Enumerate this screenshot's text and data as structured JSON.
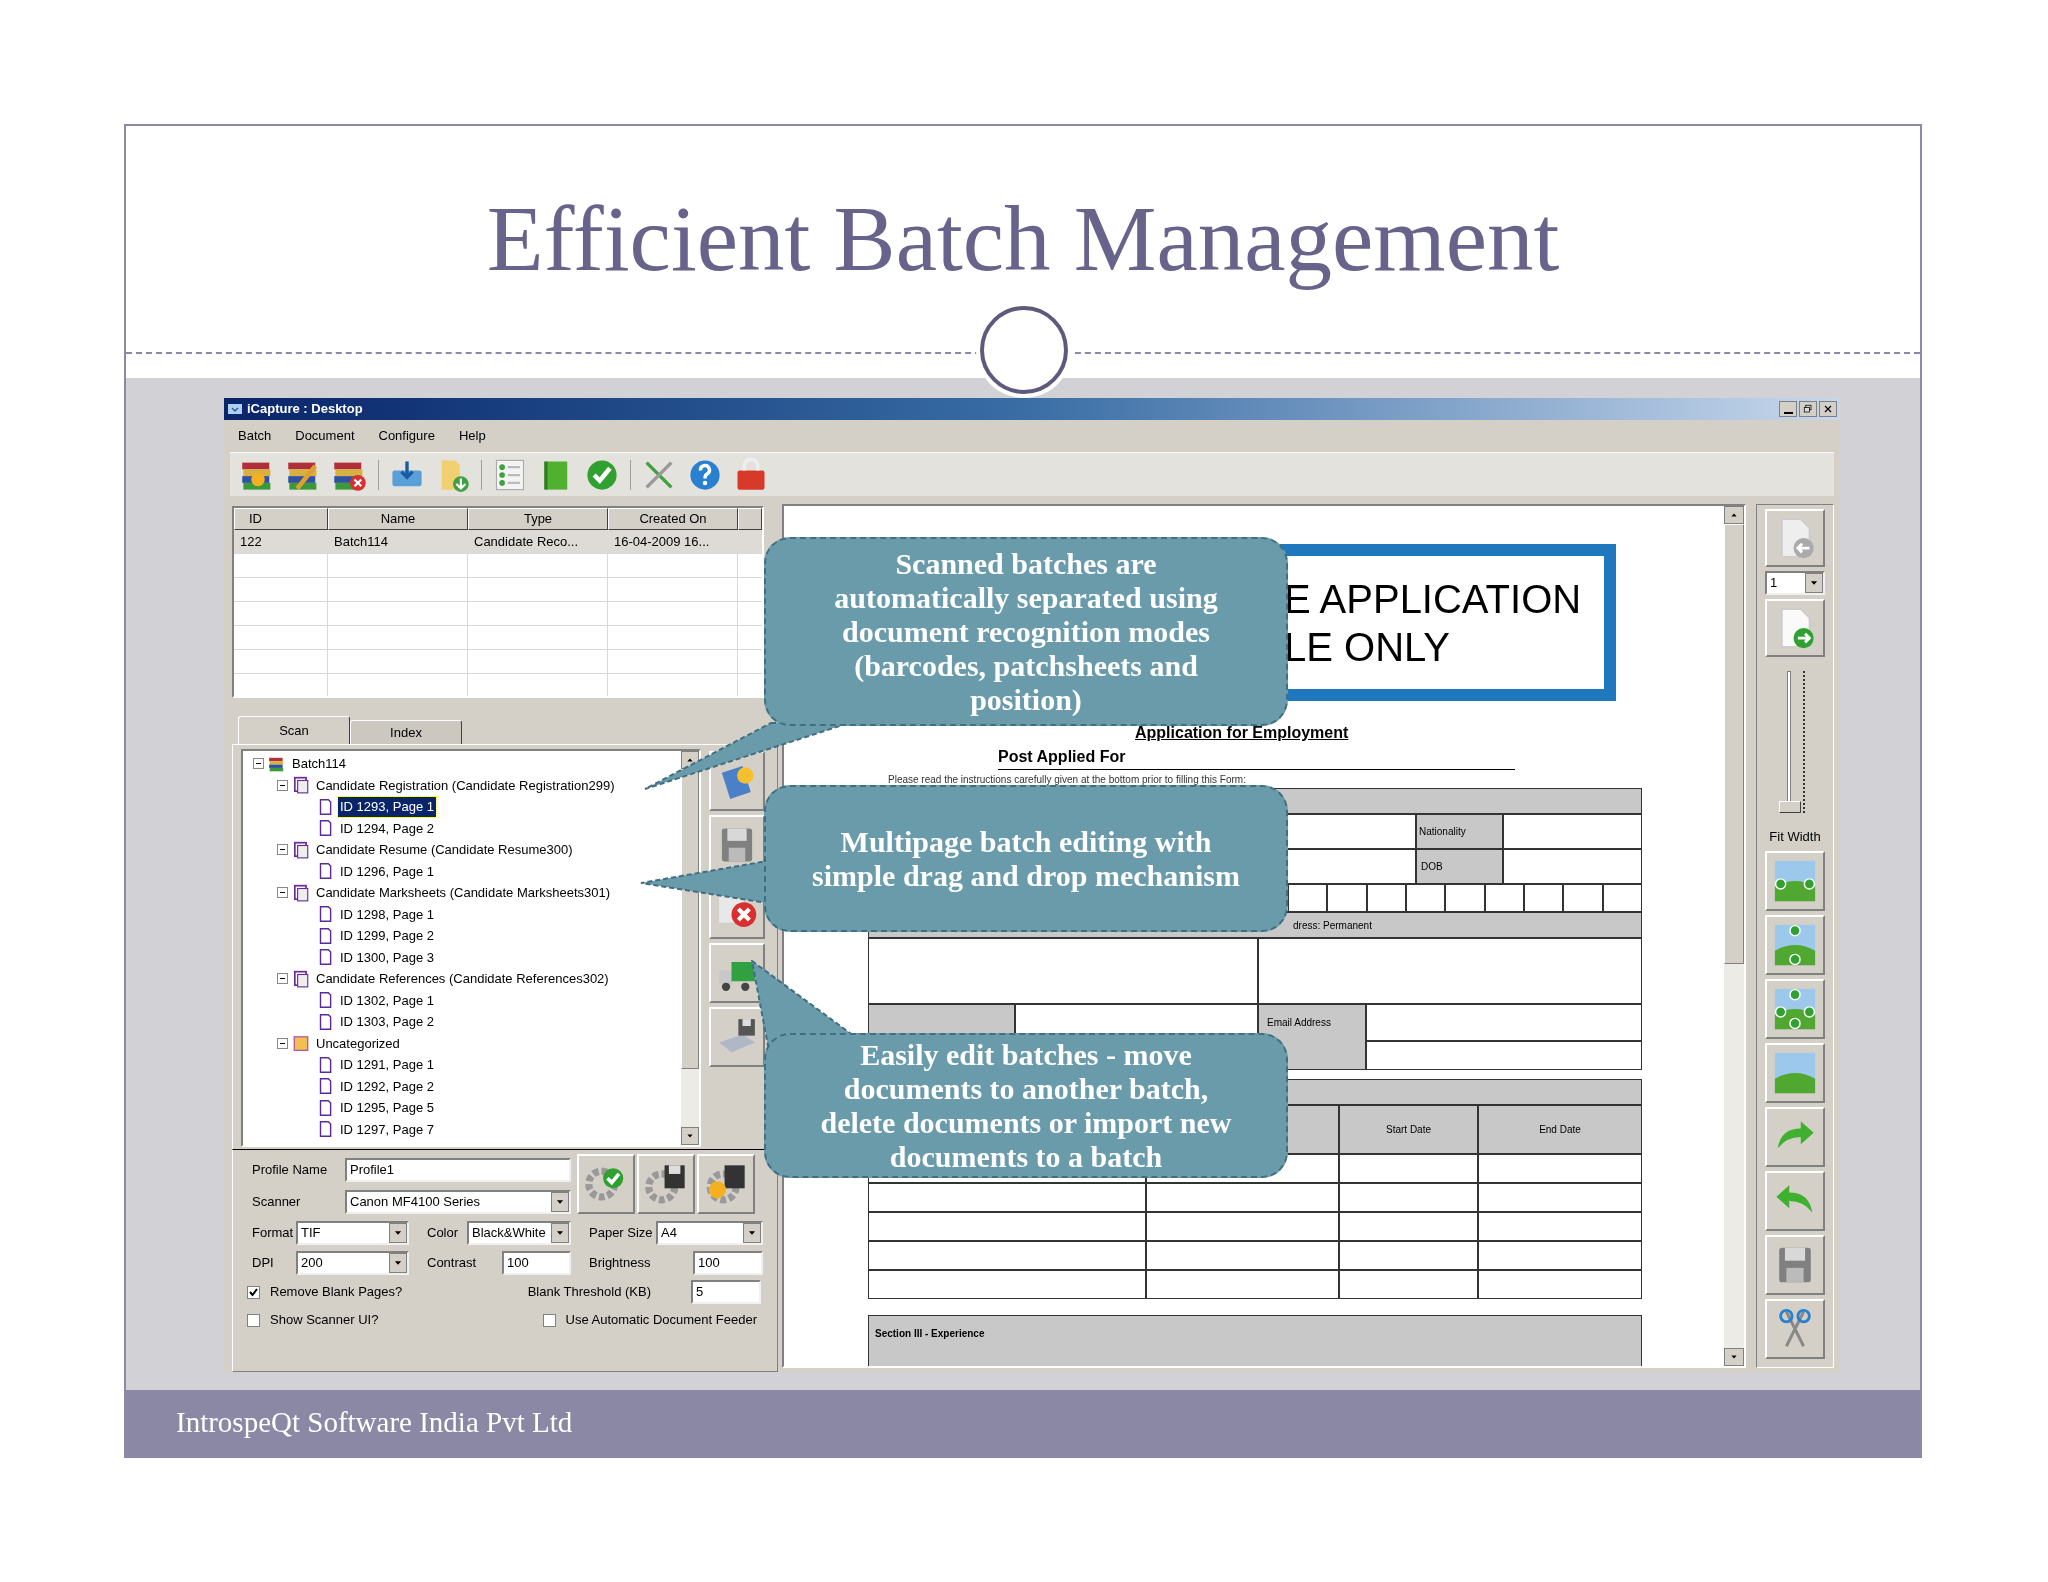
{
  "slide": {
    "title": "Efficient Batch Management",
    "footer": "IntrospeQt Software India Pvt Ltd"
  },
  "window": {
    "title": "iCapture : Desktop"
  },
  "menu": [
    "Batch",
    "Document",
    "Configure",
    "Help"
  ],
  "batch_table": {
    "columns": [
      "ID",
      "Name",
      "Type",
      "Created On"
    ],
    "rows": [
      {
        "cells": [
          "122",
          "Batch114",
          "Candidate Reco...",
          "16-04-2009 16..."
        ],
        "selected": true
      }
    ]
  },
  "tabs": [
    {
      "label": "Scan",
      "selected": true
    },
    {
      "label": "Index",
      "selected": false
    }
  ],
  "tree": {
    "label": "Batch114",
    "kind": "batch",
    "expanded": true,
    "children": [
      {
        "label": "Candidate Registration (Candidate Registration299)",
        "kind": "group",
        "expanded": true,
        "children": [
          {
            "label": "ID 1293, Page 1",
            "kind": "page",
            "selected": true
          },
          {
            "label": "ID 1294, Page 2",
            "kind": "page",
            "selected": false
          }
        ]
      },
      {
        "label": "Candidate Resume (Candidate Resume300)",
        "kind": "group",
        "expanded": true,
        "children": [
          {
            "label": "ID 1296, Page 1",
            "kind": "page",
            "selected": false
          }
        ]
      },
      {
        "label": "Candidate Marksheets (Candidate Marksheets301)",
        "kind": "group",
        "expanded": true,
        "children": [
          {
            "label": "ID 1298, Page 1",
            "kind": "page",
            "selected": false
          },
          {
            "label": "ID 1299, Page 2",
            "kind": "page",
            "selected": false
          },
          {
            "label": "ID 1300, Page 3",
            "kind": "page",
            "selected": false
          }
        ]
      },
      {
        "label": "Candidate References (Candidate References302)",
        "kind": "group",
        "expanded": true,
        "children": [
          {
            "label": "ID 1302, Page 1",
            "kind": "page",
            "selected": false
          },
          {
            "label": "ID 1303, Page 2",
            "kind": "page",
            "selected": false
          }
        ]
      },
      {
        "label": "Uncategorized",
        "kind": "folder",
        "expanded": true,
        "children": [
          {
            "label": "ID 1291, Page 1",
            "kind": "page",
            "selected": false
          },
          {
            "label": "ID 1292, Page 2",
            "kind": "page",
            "selected": false
          },
          {
            "label": "ID 1295, Page 5",
            "kind": "page",
            "selected": false
          },
          {
            "label": "ID 1297, Page 7",
            "kind": "page",
            "selected": false
          }
        ]
      }
    ]
  },
  "profile": {
    "name_field": {
      "label": "Profile Name",
      "value": "Profile1"
    },
    "scanner_field": {
      "label": "Scanner",
      "value": "Canon MF4100 Series"
    },
    "row_a": [
      {
        "label": "Format",
        "value": "TIF",
        "kind": "select"
      },
      {
        "label": "Color",
        "value": "Black&White",
        "kind": "select"
      },
      {
        "label": "Paper Size",
        "value": "A4",
        "kind": "select"
      }
    ],
    "row_b": [
      {
        "label": "DPI",
        "value": "200",
        "kind": "select"
      },
      {
        "label": "Contrast",
        "value": "100",
        "kind": "text"
      },
      {
        "label": "Brightness",
        "value": "100",
        "kind": "text"
      }
    ],
    "remove_blank": {
      "label": "Remove Blank Pages?",
      "checked": true
    },
    "threshold": {
      "label": "Blank Threshold (KB)",
      "value": "5"
    },
    "show_ui": {
      "label": "Show Scanner UI?",
      "checked": false
    },
    "adf": {
      "label": "Use Automatic Document Feeder",
      "checked": false
    }
  },
  "document": {
    "banner": [
      "E APPLICATION",
      "LE ONLY"
    ],
    "form_title": "Application for Employment",
    "post_label": "Post Applied For",
    "instructions": "Please read the instructions carefully given at the bottom prior to filling this Form:",
    "nationality": "Nationality",
    "dob": "DOB",
    "address": "dress: Permanent",
    "email": "Email Address",
    "start_date": "Start Date",
    "end_date": "End Date",
    "section": "Section III - Experience"
  },
  "viewer_tools": {
    "page": "1",
    "fit_label": "Fit Width",
    "zoom": {
      "level": 0
    }
  },
  "callouts": [
    "Scanned batches are automatically separated using document recognition modes (barcodes, patchsheets and position)",
    "Multipage batch editing with simple drag and drop mechanism",
    "Easily edit batches - move documents to another batch, delete documents or import new documents to a batch"
  ]
}
